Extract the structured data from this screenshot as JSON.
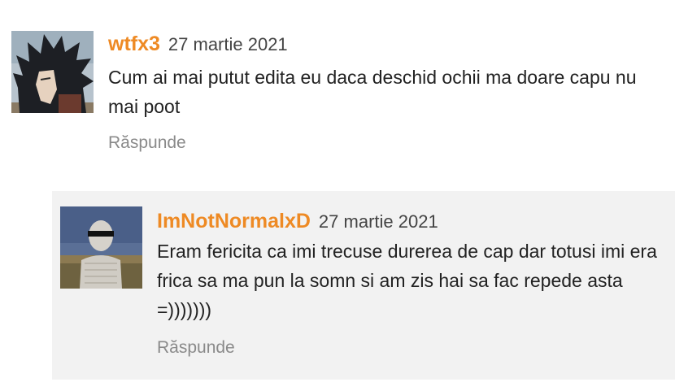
{
  "comments": [
    {
      "username": "wtfx3",
      "date": "27 martie 2021",
      "text": "Cum ai mai putut edita eu daca deschid ochii ma doare capu nu mai poot",
      "reply_label": "Răspunde"
    },
    {
      "username": "ImNotNormalxD",
      "date": "27 martie 2021",
      "text": "Eram fericita ca imi trecuse durerea de cap dar totusi imi era frica sa ma pun la somn si am zis hai sa fac repede asta =)))))))",
      "reply_label": "Răspunde"
    }
  ]
}
